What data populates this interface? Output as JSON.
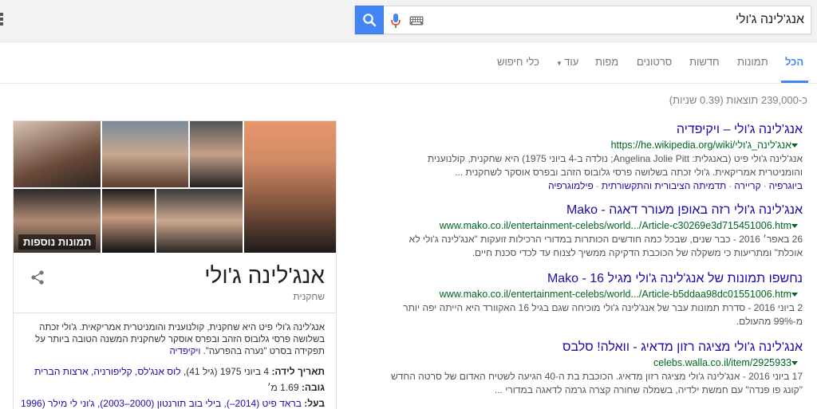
{
  "search": {
    "query": "אנג'לינה ג'ולי"
  },
  "tabs": [
    "הכל",
    "תמונות",
    "חדשות",
    "סרטונים",
    "מפות",
    "עוד",
    "כלי חיפוש"
  ],
  "stats": "כ-239,000 תוצאות (0.39 שניות)",
  "results": [
    {
      "title": "אנג'לינה ג'ולי – ויקיפדיה",
      "url": "https://he.wikipedia.org/wiki/אנג'לינה_ג'ולי",
      "snippet": "אנג'לינה ג'ולי פיט (באנגלית: Angelina Jolie Pitt; נולדה ב-4 ביוני 1975) היא שחקנית, קולנוענית והומניטרית אמריקאית. ג'ולי זכתה בשלושה פרסי גלובוס הזהב ובפרס אוסקר לשחקנית ...",
      "links": [
        "ביוגרפיה",
        "קריירה",
        "תדמיתה הציבורית והתקשורתית",
        "פילמוגרפיה"
      ]
    },
    {
      "title": "אנג'לינה ג'ולי רזה באופן מעורר דאגה - Mako",
      "url": "www.mako.co.il/entertainment-celebs/world.../Article-c30269e3d715451006.htm",
      "snippet": "26 באפר׳ 2016 - כבר שנים, שבכל כמה חודשים הכותרות במדורי הרכילות זועקות \"אנג'לינה ג'ולי לא אוכלת\" ומתריעות כי משקלה של הכוכבת הדקיקה ממשיך לצנוח עד לכדי סכנת חיים."
    },
    {
      "title": "נחשפו תמונות של אנג'לינה ג'ולי מגיל 16 - Mako",
      "url": "www.mako.co.il/entertainment-celebs/world.../Article-b5ddaa98dc01551006.htm",
      "snippet": "2 ביוני 2016 - סדרת תמונות עבר של אנג'לינה ג'ולי מוכיחה שגם בגיל 16 האקוורד היא הייתה יפה יותר מ-99% מהעולם."
    },
    {
      "title": "אנג'לינה ג'ולי מציגה רזון מדאיג - וואלה! סלבס",
      "url": "celebs.walla.co.il/item/2925933",
      "snippet": "17 ביוני 2016 - אנג'לינה ג'ולי מציגה רזון מדאיג. הכוכבת בת ה-40 הגיעה לשטיח האדום של סרטה החדש \"קונג פו פנדה\" עם חמשת ילדיה, בשמלה שחורה קצרה גרמה לדאגה במדורי ..."
    }
  ],
  "kp": {
    "more_images": "תמונות נוספות",
    "title": "אנג'לינה ג'ולי",
    "subtitle": "שחקנית",
    "desc": "אנג'לינה ג'ולי פיט היא שחקנית, קולנוענית והומניטרית אמריקאית. ג'ולי זכתה בשלושה פרסי גלובוס הזהב ובפרס אוסקר לשחקנית המשנה הטובה ביותר על תפקידה בסרט \"נערה בהפרעה\".",
    "desc_link": "ויקיפדיה",
    "born_label": "תאריך לידה:",
    "born_value": "4 ביוני 1975 (גיל 41),",
    "born_place": "לוס אנג'לס, קליפורניה, ארצות הברית",
    "height_label": "גובה:",
    "height_value": "1.69 מ׳",
    "spouse_label": "בעל:",
    "spouse_value": "בראד פיט (2014–), בילי בוב תורנטון (2000–2003), ג'וני לי מילר (1996–"
  }
}
